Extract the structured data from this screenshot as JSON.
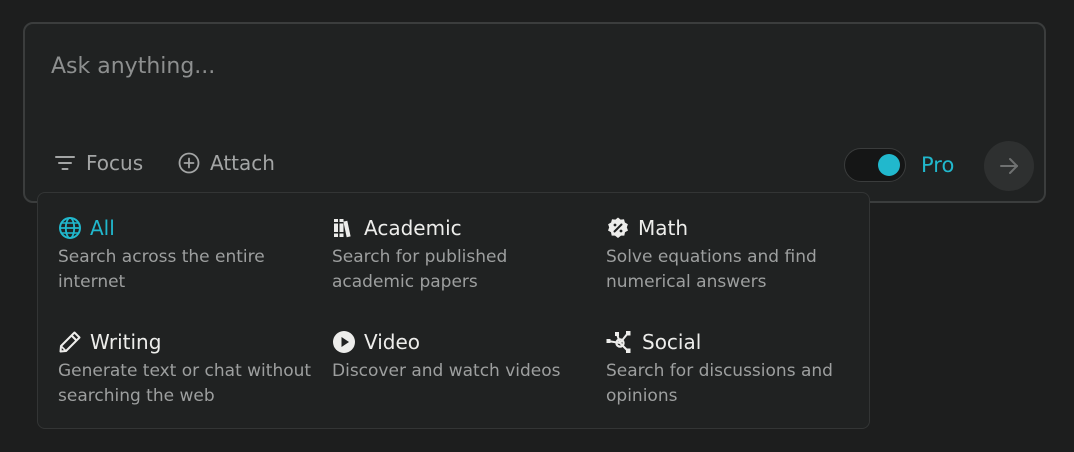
{
  "composer": {
    "placeholder": "Ask anything...",
    "focus_label": "Focus",
    "attach_label": "Attach",
    "pro_label": "Pro",
    "pro_enabled": true
  },
  "focus_menu": {
    "options": [
      {
        "icon": "globe-icon",
        "title": "All",
        "description": "Search across the entire internet",
        "selected": true
      },
      {
        "icon": "books-icon",
        "title": "Academic",
        "description": "Search for published academic papers",
        "selected": false
      },
      {
        "icon": "percent-badge-icon",
        "title": "Math",
        "description": "Solve equations and find numerical answers",
        "selected": false
      },
      {
        "icon": "pencil-icon",
        "title": "Writing",
        "description": "Generate text or chat without searching the web",
        "selected": false
      },
      {
        "icon": "play-icon",
        "title": "Video",
        "description": "Discover and watch videos",
        "selected": false
      },
      {
        "icon": "social-network-icon",
        "title": "Social",
        "description": "Search for discussions and opinions",
        "selected": false
      }
    ]
  },
  "colors": {
    "accent": "#21b8cd",
    "background": "#1d1e1e",
    "panel": "#202222"
  }
}
